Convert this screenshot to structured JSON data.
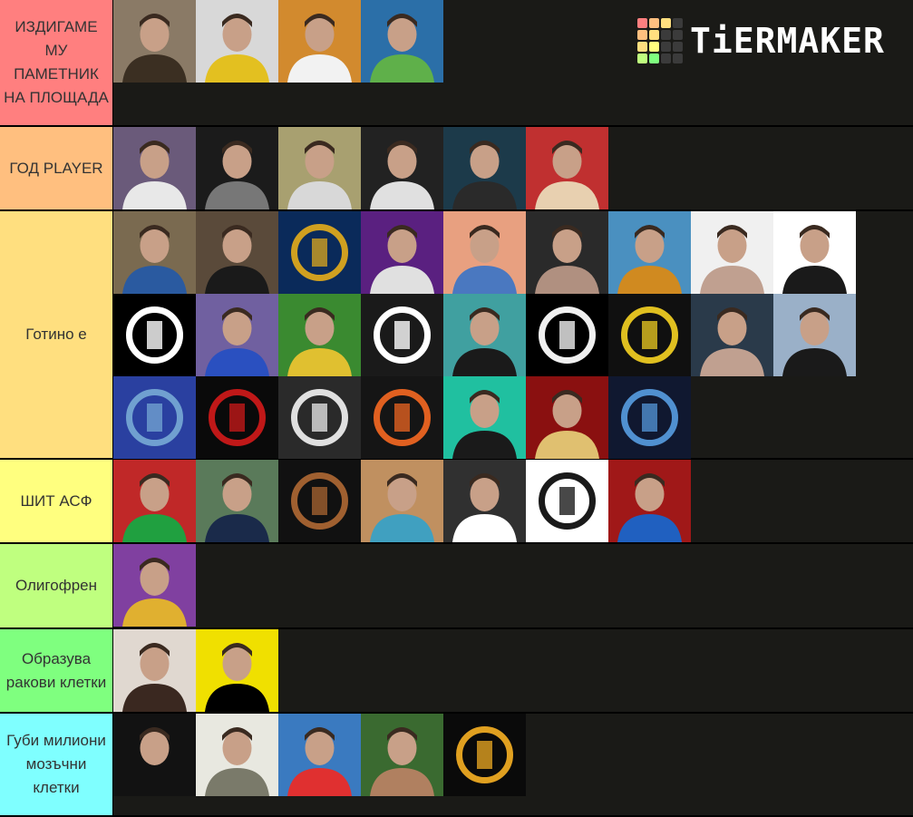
{
  "app": {
    "brand": "TiERMAKER",
    "logo_icon": "tiermaker-grid-icon"
  },
  "logo_grid_colors": [
    "#ff7f7f",
    "#ffbf7f",
    "#ffdf7f",
    "#3b3b3b",
    "#ffbf7f",
    "#ffdf7f",
    "#3b3b3b",
    "#3b3b3b",
    "#ffdf7f",
    "#ffff7f",
    "#3b3b3b",
    "#3b3b3b",
    "#bfff7f",
    "#7fff7f",
    "#3b3b3b",
    "#3b3b3b"
  ],
  "tiers": [
    {
      "label": "ИЗДИГАМЕ МУ ПАМЕТНИК НА ПЛОЩАДА",
      "color": "#ff7f7f",
      "items": [
        {
          "name": "long-haired-bearded-man",
          "bg": "#8a7a66",
          "fg": "#3b2f22"
        },
        {
          "name": "man-on-white-car",
          "bg": "#d8d8d8",
          "fg": "#e3c020"
        },
        {
          "name": "man-sunglasses-orange",
          "bg": "#d28a2e",
          "fg": "#f2f2f2"
        },
        {
          "name": "cartoon-green-hat",
          "bg": "#2b6fa8",
          "fg": "#5fb04a"
        }
      ]
    },
    {
      "label": "ГОД PLAYER",
      "color": "#ffbf7f",
      "items": [
        {
          "name": "man-at-fair",
          "bg": "#6a5a7a",
          "fg": "#e8e8e8"
        },
        {
          "name": "no-fear-bw",
          "bg": "#1b1b1b",
          "fg": "#777777"
        },
        {
          "name": "man-in-field",
          "bg": "#a8a070",
          "fg": "#d8d8d8"
        },
        {
          "name": "man-white-shirt",
          "bg": "#222222",
          "fg": "#e0e0e0"
        },
        {
          "name": "man-dark-tshirt",
          "bg": "#1c3a4a",
          "fg": "#2a2a2a"
        },
        {
          "name": "cartoon-glasses-cap",
          "bg": "#c03030",
          "fg": "#e8d0b0"
        }
      ]
    },
    {
      "label": "Готино е",
      "color": "#ffdf7f",
      "items": [
        {
          "name": "boy-straw-hat",
          "bg": "#7a6a50",
          "fg": "#2a5aa0"
        },
        {
          "name": "photographer",
          "bg": "#5a4a3a",
          "fg": "#1a1a1a"
        },
        {
          "name": "spartan-alfa-logo",
          "bg": "#0a2a5a",
          "fg": "#d0a020"
        },
        {
          "name": "purple-ok-sign",
          "bg": "#5a2080",
          "fg": "#e0e0e0"
        },
        {
          "name": "man-peach-bg",
          "bg": "#e8a080",
          "fg": "#4a78c0"
        },
        {
          "name": "dark-hair-man",
          "bg": "#2a2a2a",
          "fg": "#b09080"
        },
        {
          "name": "cartoon-duck-headphones",
          "bg": "#4a90c0",
          "fg": "#d08a20"
        },
        {
          "name": "laughing-man",
          "bg": "#f0f0f0",
          "fg": "#c0a090"
        },
        {
          "name": "smiling-man-circle",
          "bg": "#ffffff",
          "fg": "#1a1a1a"
        },
        {
          "name": "dido-logo",
          "bg": "#000000",
          "fg": "#ffffff"
        },
        {
          "name": "man-with-cat",
          "bg": "#7060a0",
          "fg": "#2a50c0"
        },
        {
          "name": "cartoon-soccer",
          "bg": "#3a8a30",
          "fg": "#e0c030"
        },
        {
          "name": "hb-logo",
          "bg": "#1a1a1a",
          "fg": "#ffffff"
        },
        {
          "name": "boy-teal-bg",
          "bg": "#40a0a0",
          "fg": "#1a1a1a"
        },
        {
          "name": "skull-face",
          "bg": "#000000",
          "fg": "#f0f0f0"
        },
        {
          "name": "gorilla-logo",
          "bg": "#101010",
          "fg": "#e0c020"
        },
        {
          "name": "man-profile",
          "bg": "#2a3a4a",
          "fg": "#c0a090"
        },
        {
          "name": "man-on-car",
          "bg": "#9ab0c8",
          "fg": "#1a1a1a"
        },
        {
          "name": "cleaner-logo",
          "bg": "#2a40a0",
          "fg": "#70a0d0"
        },
        {
          "name": "red-s-logo",
          "bg": "#0a0a0a",
          "fg": "#c01818"
        },
        {
          "name": "army-logo",
          "bg": "#2a2a2a",
          "fg": "#e0e0e0"
        },
        {
          "name": "the-sound-tv",
          "bg": "#151515",
          "fg": "#e06020"
        },
        {
          "name": "headphones-man",
          "bg": "#20c0a0",
          "fg": "#1a1a1a"
        },
        {
          "name": "man-red-light",
          "bg": "#8a1010",
          "fg": "#e0c070"
        },
        {
          "name": "hooded-logo",
          "bg": "#101830",
          "fg": "#5090d0"
        }
      ]
    },
    {
      "label": "ШИТ АСФ",
      "color": "#ffff7f",
      "items": [
        {
          "name": "couple-red",
          "bg": "#c02828",
          "fg": "#20a040"
        },
        {
          "name": "man-outdoors",
          "bg": "#5a7a5a",
          "fg": "#1a2a4a"
        },
        {
          "name": "deer-logo",
          "bg": "#111111",
          "fg": "#a06030"
        },
        {
          "name": "girl-bokeh",
          "bg": "#c09060",
          "fg": "#40a0c0"
        },
        {
          "name": "subscribe-girl",
          "bg": "#303030",
          "fg": "#ffffff"
        },
        {
          "name": "r-lion-logo",
          "bg": "#ffffff",
          "fg": "#1a1a1a"
        },
        {
          "name": "gamer-silhouette",
          "bg": "#a01818",
          "fg": "#2060c0"
        }
      ]
    },
    {
      "label": "Олигофрен",
      "color": "#bfff7f",
      "items": [
        {
          "name": "couple-laughing-emoji",
          "bg": "#8040a0",
          "fg": "#e0b030"
        }
      ]
    },
    {
      "label": "Образува ракови клетки",
      "color": "#7fff7f",
      "items": [
        {
          "name": "curly-hair-woman",
          "bg": "#e0d8d0",
          "fg": "#3a2820"
        },
        {
          "name": "man-yellow-bg",
          "bg": "#f0e000",
          "fg": "#000000"
        }
      ]
    },
    {
      "label": "Губи милиони мозъчни клетки",
      "color": "#7fffff",
      "items": [
        {
          "name": "blank-dark",
          "bg": "#121212",
          "fg": "#121212"
        },
        {
          "name": "white-cat",
          "bg": "#e8e8e0",
          "fg": "#7a7a6a"
        },
        {
          "name": "two-boys",
          "bg": "#3a7ac0",
          "fg": "#e03030"
        },
        {
          "name": "curly-boy",
          "bg": "#3a6a30",
          "fg": "#b08060"
        },
        {
          "name": "ii-logo",
          "bg": "#0a0a0a",
          "fg": "#e0a020"
        }
      ]
    }
  ]
}
